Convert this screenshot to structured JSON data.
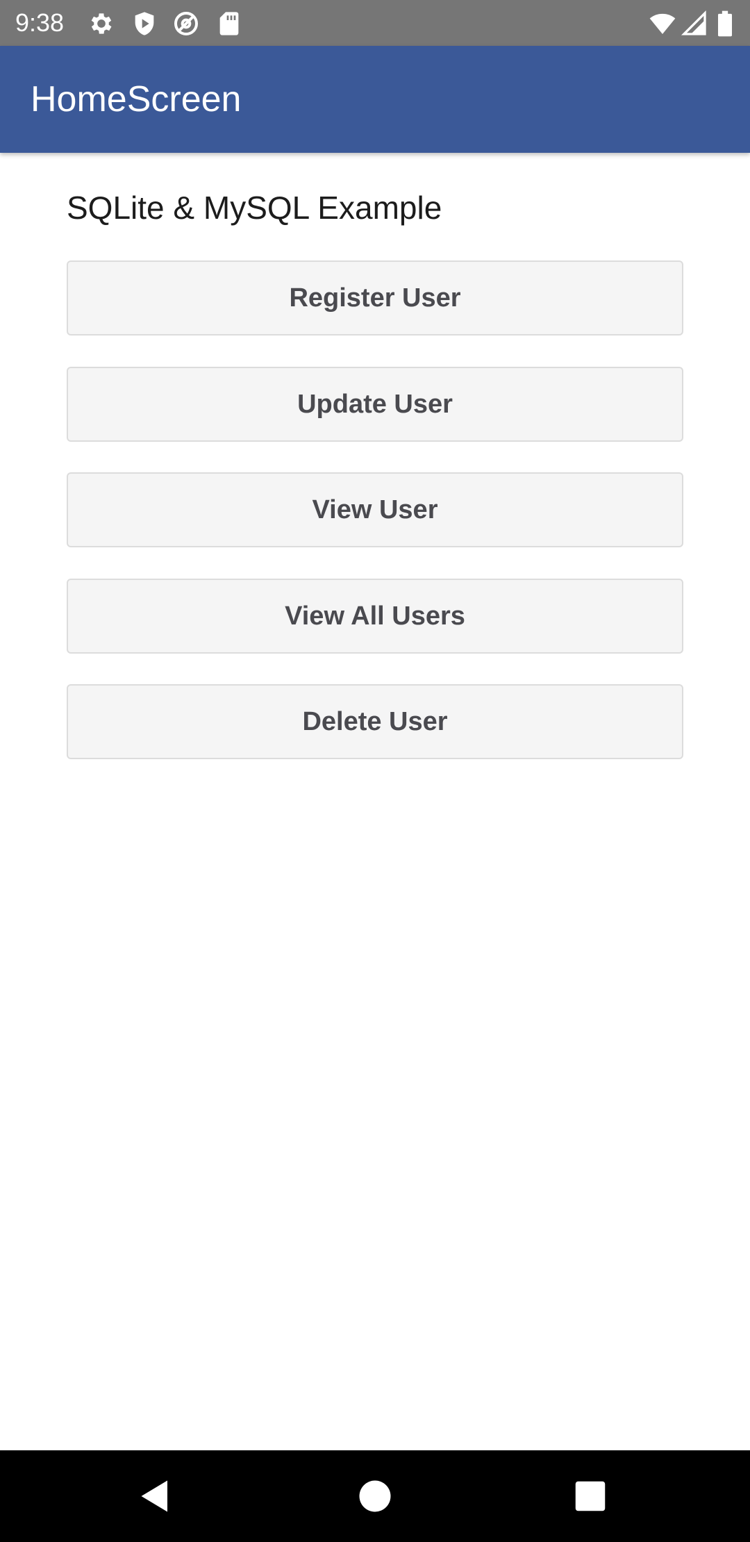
{
  "status_bar": {
    "time": "9:38",
    "left_icons": [
      "gear-icon",
      "shield-icon",
      "at-sign-icon",
      "sd-card-icon"
    ],
    "right_icons": [
      "wifi-icon",
      "cellular-signal-icon",
      "battery-icon"
    ],
    "background": "#767676"
  },
  "app_bar": {
    "title": "HomeScreen",
    "color": "#3b5998"
  },
  "main": {
    "heading": "SQLite & MySQL Example",
    "buttons": [
      {
        "label": "Register User"
      },
      {
        "label": "Update User"
      },
      {
        "label": "View User"
      },
      {
        "label": "View All Users"
      },
      {
        "label": "Delete User"
      }
    ]
  },
  "nav_bar": {
    "buttons": [
      "back-icon",
      "home-icon",
      "recents-icon"
    ]
  }
}
